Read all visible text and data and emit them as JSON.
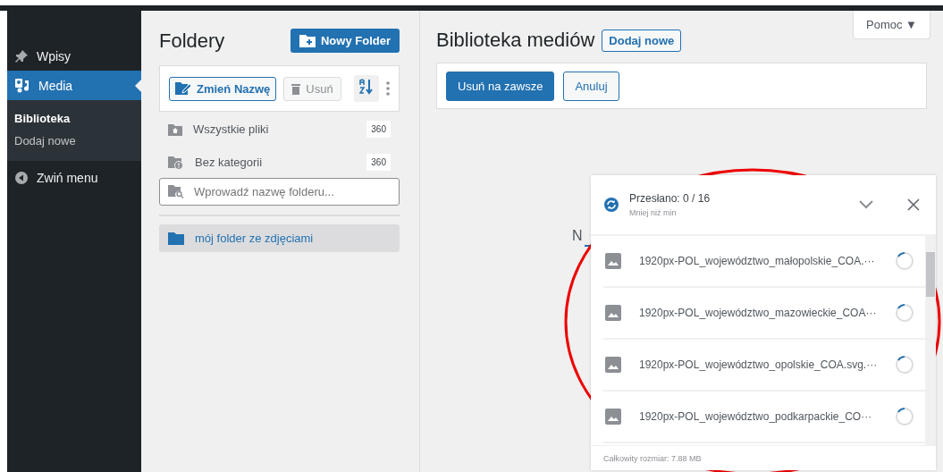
{
  "sidebar": {
    "items": [
      {
        "label": "Wpisy",
        "selected": false
      },
      {
        "label": "Media",
        "selected": true,
        "children": [
          {
            "label": "Biblioteka",
            "selected": true
          },
          {
            "label": "Dodaj nowe",
            "selected": false
          }
        ]
      },
      {
        "label": "Zwiń menu",
        "selected": false
      }
    ]
  },
  "folders": {
    "title": "Foldery",
    "new_button": "Nowy Folder",
    "toolbar": {
      "rename": "Zmień Nazwę",
      "delete": "Usuń",
      "delete_disabled": true
    },
    "items": [
      {
        "label": "Wszystkie pliki",
        "count": "360"
      },
      {
        "label": "Bez kategorii",
        "count": "360"
      }
    ],
    "search": {
      "placeholder": "Wprowadź nazwę folderu..."
    },
    "tree": [
      {
        "label": "mój folder ze zdjęciami",
        "selected": true
      }
    ]
  },
  "main": {
    "title": "Biblioteka mediów",
    "add_button": "Dodaj nowe",
    "help_tab": "Pomoc ▼",
    "actions": [
      {
        "label": "Usuń na zawsze",
        "kind": "primary"
      },
      {
        "label": "Anuluj",
        "kind": "secondary"
      }
    ],
    "behind_text": "N"
  },
  "upload": {
    "title": "Przesłano: 0 / 16",
    "subtitle": "Mniej niż min",
    "files": [
      {
        "name": "1920px-POL_województwo_małopolskie_COA.···"
      },
      {
        "name": "1920px-POL_województwo_mazowieckie_COA···"
      },
      {
        "name": "1920px-POL_województwo_opolskie_COA.svg.···"
      },
      {
        "name": "1920px-POL_województwo_podkarpackie_CO···"
      }
    ],
    "footer": "Całkowity rozmiar: 7.88 MB"
  }
}
